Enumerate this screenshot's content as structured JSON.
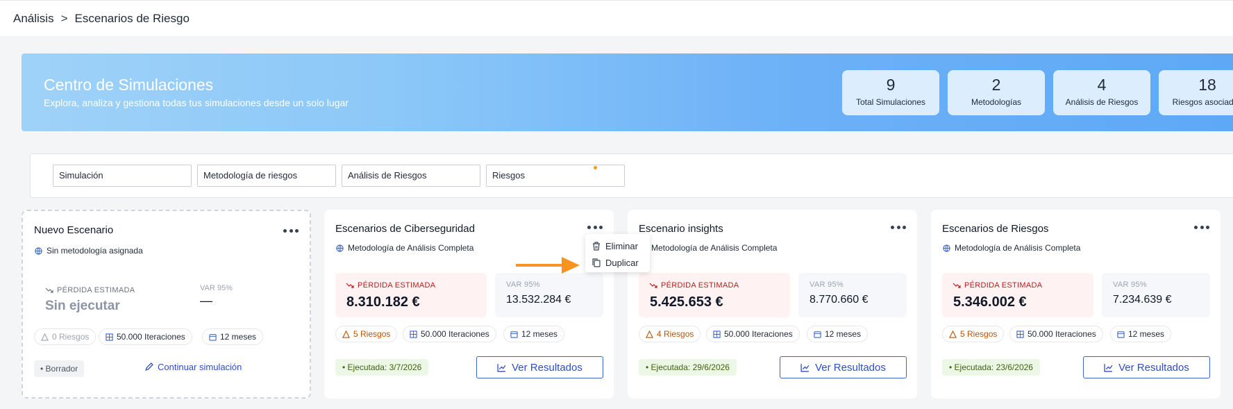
{
  "breadcrumb": {
    "items": [
      "Análisis",
      "Escenarios de Riesgo"
    ],
    "separator": ">"
  },
  "banner": {
    "title": "Centro de Simulaciones",
    "subtitle": "Explora, analiza y gestiona todas tus simulaciones desde un solo lugar",
    "stats": [
      {
        "value": "9",
        "label": "Total Simulaciones"
      },
      {
        "value": "2",
        "label": "Metodologías"
      },
      {
        "value": "4",
        "label": "Análisis de Riesgos"
      },
      {
        "value": "18",
        "label": "Riesgos asociados"
      }
    ]
  },
  "filters": [
    {
      "placeholder": "Simulación"
    },
    {
      "placeholder": "Metodología de riesgos"
    },
    {
      "placeholder": "Análisis de Riesgos"
    },
    {
      "placeholder": "Riesgos"
    }
  ],
  "draft_card": {
    "title": "Nuevo Escenario",
    "methodology": "Sin metodología asignada",
    "loss_label": "PÉRDIDA ESTIMADA",
    "loss_value": "Sin ejecutar",
    "var_label": "VAR 95%",
    "var_value": "—",
    "chips": [
      "0 Riesgos",
      "50.000 Iteraciones",
      "12 meses"
    ],
    "status": "• Borrador",
    "continue_label": "Continuar simulación"
  },
  "cards": [
    {
      "title": "Escenarios de Ciberseguridad",
      "methodology": "Metodología de Análisis Completa",
      "loss_label": "PÉRDIDA ESTIMADA",
      "loss_value": "8.310.182 €",
      "var_label": "VAR 95%",
      "var_value": "13.532.284 €",
      "chips": [
        "5 Riesgos",
        "50.000 Iteraciones",
        "12 meses"
      ],
      "executed": "• Ejecutada: 3/7/2026",
      "results_label": "Ver Resultados"
    },
    {
      "title": "Escenario insights",
      "methodology": "Metodología de Análisis Completa",
      "loss_label": "PÉRDIDA ESTIMADA",
      "loss_value": "5.425.653 €",
      "var_label": "VAR 95%",
      "var_value": "8.770.660 €",
      "chips": [
        "4 Riesgos",
        "50.000 Iteraciones",
        "12 meses"
      ],
      "executed": "• Ejecutada: 29/6/2026",
      "results_label": "Ver Resultados"
    },
    {
      "title": "Escenarios de Riesgos",
      "methodology": "Metodología de Análisis Completa",
      "loss_label": "PÉRDIDA ESTIMADA",
      "loss_value": "5.346.002 €",
      "var_label": "VAR 95%",
      "var_value": "7.234.639 €",
      "chips": [
        "5 Riesgos",
        "50.000 Iteraciones",
        "12 meses"
      ],
      "executed": "• Ejecutada: 23/6/2026",
      "results_label": "Ver Resultados"
    }
  ],
  "context_menu": {
    "items": [
      "Eliminar",
      "Duplicar"
    ]
  },
  "colors": {
    "accent": "#2d4fc0",
    "arrow": "#f7931e",
    "loss_bg": "#fef2f2",
    "executed_bg": "#ecf7e6"
  }
}
